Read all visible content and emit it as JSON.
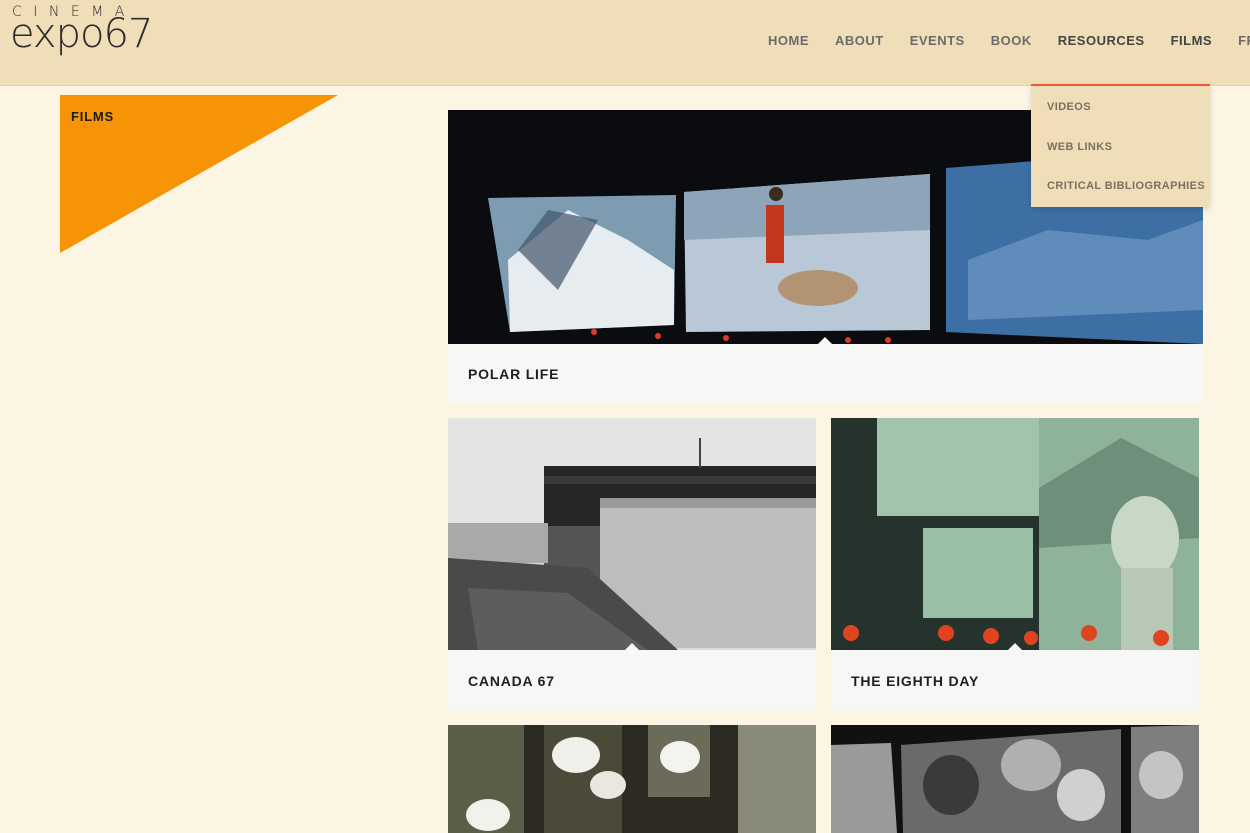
{
  "logo": {
    "top": "CINEMA",
    "main": "expo67"
  },
  "nav": {
    "items": [
      "HOME",
      "ABOUT",
      "EVENTS",
      "BOOK",
      "RESOURCES",
      "FILMS",
      "FRAN"
    ]
  },
  "dropdown": {
    "items": [
      "VIDEOS",
      "WEB LINKS",
      "CRITICAL BIBLIOGRAPHIES"
    ]
  },
  "section": {
    "label": "FILMS"
  },
  "films": [
    {
      "title": "POLAR LIFE"
    },
    {
      "title": "CANADA 67"
    },
    {
      "title": "THE EIGHTH DAY"
    }
  ],
  "colors": {
    "header": "#f0deb8",
    "background": "#fdf5e4",
    "accent_orange": "#f79406",
    "dropdown_border": "#e85a3a"
  }
}
